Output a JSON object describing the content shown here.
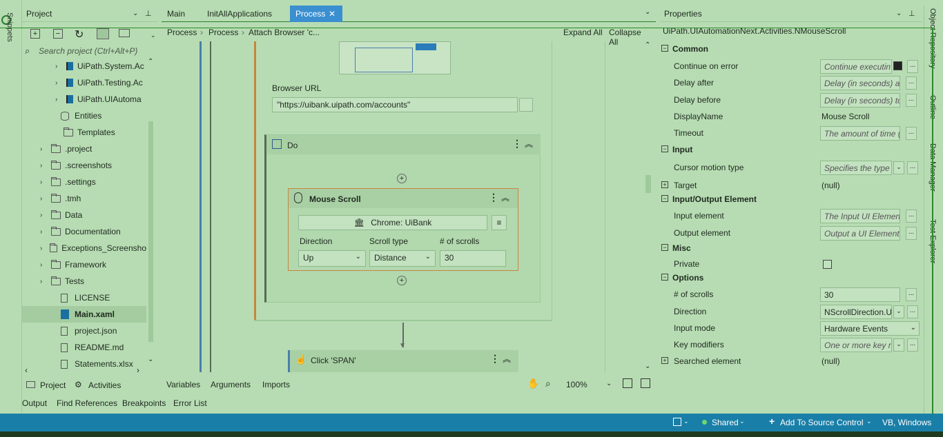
{
  "left_strip": {
    "label": "Snippets"
  },
  "project_panel": {
    "title": "Project",
    "search_placeholder": "Search project (Ctrl+Alt+P)",
    "items": [
      {
        "label": "UiPath.System.Ac",
        "type": "pkg"
      },
      {
        "label": "UiPath.Testing.Ac",
        "type": "pkg"
      },
      {
        "label": "UiPath.UIAutoma",
        "type": "pkg"
      },
      {
        "label": "Entities",
        "type": "db"
      },
      {
        "label": "Templates",
        "type": "folder"
      },
      {
        "label": ".project",
        "type": "folder"
      },
      {
        "label": ".screenshots",
        "type": "folder"
      },
      {
        "label": ".settings",
        "type": "folder"
      },
      {
        "label": ".tmh",
        "type": "folder"
      },
      {
        "label": "Data",
        "type": "folder"
      },
      {
        "label": "Documentation",
        "type": "folder"
      },
      {
        "label": "Exceptions_Screensho",
        "type": "folder"
      },
      {
        "label": "Framework",
        "type": "folder"
      },
      {
        "label": "Tests",
        "type": "folder"
      },
      {
        "label": "LICENSE",
        "type": "file"
      },
      {
        "label": "Main.xaml",
        "type": "xaml"
      },
      {
        "label": "project.json",
        "type": "file"
      },
      {
        "label": "README.md",
        "type": "file"
      },
      {
        "label": "Statements.xlsx",
        "type": "file"
      }
    ],
    "tabs": {
      "project": "Project",
      "activities": "Activities"
    }
  },
  "editor_tabs": {
    "main": "Main",
    "init": "InitAllApplications",
    "process": "Process"
  },
  "breadcrumb": {
    "items": [
      "Process",
      "Process",
      "Attach Browser 'c..."
    ],
    "expand_all": "Expand All",
    "collapse_all": "Collapse All"
  },
  "designer": {
    "browser_url_label": "Browser URL",
    "browser_url_value": "\"https://uibank.uipath.com/accounts\"",
    "do_title": "Do",
    "mouse_scroll": {
      "title": "Mouse Scroll",
      "target": "Chrome: UiBank",
      "direction_label": "Direction",
      "direction_value": "Up",
      "scroll_type_label": "Scroll type",
      "scroll_type_value": "Distance",
      "scrolls_label": "# of scrolls",
      "scrolls_value": "30"
    },
    "click_title": "Click 'SPAN'",
    "footer": {
      "variables": "Variables",
      "arguments": "Arguments",
      "imports": "Imports",
      "zoom": "100%"
    }
  },
  "properties": {
    "title": "Properties",
    "type_name": "UiPath.UIAutomationNext.Activities.NMouseScroll",
    "common": "Common",
    "continue_on_error": "Continue on error",
    "continue_on_error_ph": "Continue executin",
    "delay_after": "Delay after",
    "delay_after_ph": "Delay (in seconds) aft",
    "delay_before": "Delay before",
    "delay_before_ph": "Delay (in seconds) to",
    "display_name": "DisplayName",
    "display_name_value": "Mouse Scroll",
    "timeout": "Timeout",
    "timeout_ph": "The amount of time (i",
    "input": "Input",
    "cursor_motion": "Cursor motion type",
    "cursor_motion_ph": "Specifies the type",
    "target": "Target",
    "target_value": "(null)",
    "io_element": "Input/Output Element",
    "input_element": "Input element",
    "input_element_ph": "The Input UI Element",
    "output_element": "Output element",
    "output_element_ph": "Output a UI Element t",
    "misc": "Misc",
    "private": "Private",
    "options": "Options",
    "num_scrolls": "# of scrolls",
    "num_scrolls_value": "30",
    "direction": "Direction",
    "direction_value": "NScrollDirection.U",
    "input_mode": "Input mode",
    "input_mode_value": "Hardware Events",
    "key_modifiers": "Key modifiers",
    "key_modifiers_ph": "One or more key r",
    "searched_element": "Searched element",
    "searched_element_value": "(null)"
  },
  "right_strip": {
    "object_repository": "Object Repository",
    "outline": "Outline",
    "data_manager": "Data Manager",
    "test_explorer": "Test Explorer"
  },
  "bottom_tabs": {
    "output": "Output",
    "find_refs": "Find References",
    "breakpoints": "Breakpoints",
    "error_list": "Error List"
  },
  "status": {
    "shared": "Shared",
    "source_control": "Add To Source Control",
    "lang": "VB, Windows"
  }
}
